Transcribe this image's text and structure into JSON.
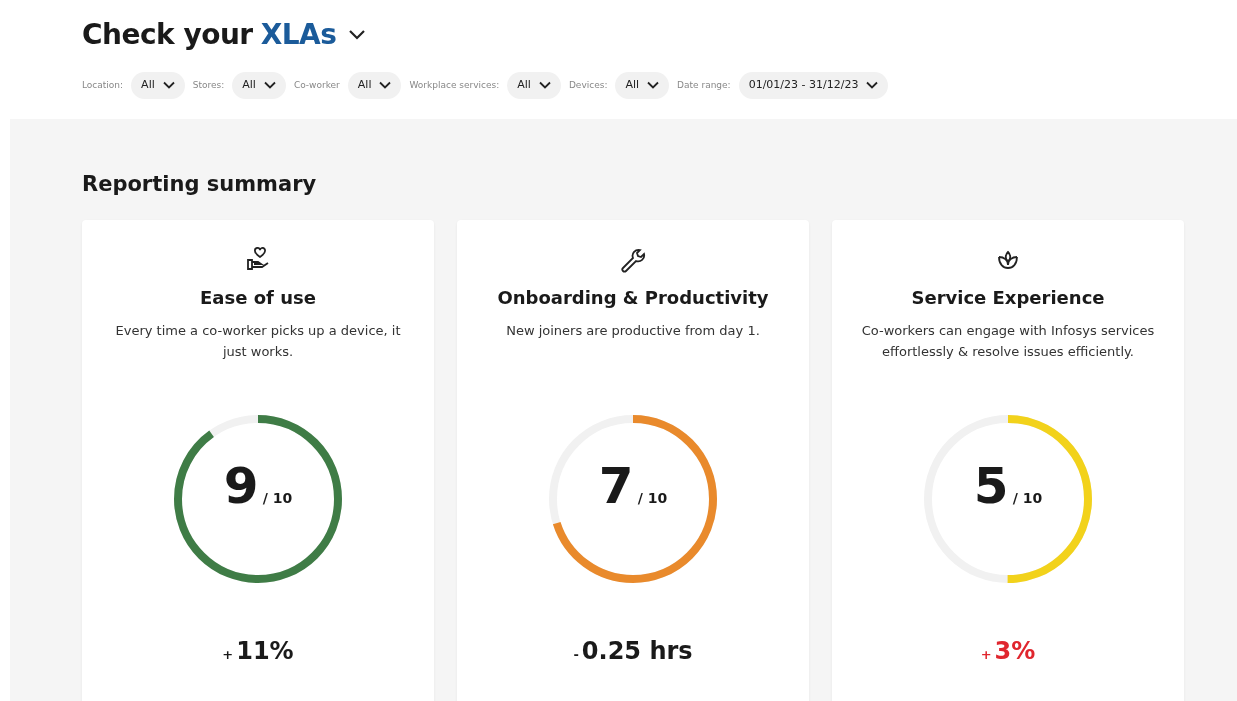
{
  "header": {
    "title_prefix": "Check your",
    "title_highlight": "XLAs"
  },
  "filters": [
    {
      "label": "Location:",
      "value": "All"
    },
    {
      "label": "Stores:",
      "value": "All"
    },
    {
      "label": "Co-worker",
      "value": "All"
    },
    {
      "label": "Workplace services:",
      "value": "All"
    },
    {
      "label": "Devices:",
      "value": "All"
    },
    {
      "label": "Date range:",
      "value": "01/01/23 - 31/12/23"
    }
  ],
  "summary": {
    "title": "Reporting summary",
    "cards": [
      {
        "title": "Ease of use",
        "description": "Every time a co-worker picks up a device, it just works.",
        "score": "9",
        "max": "/ 10",
        "level": 0.9,
        "color": "#3f7c46",
        "delta": {
          "sign": "+",
          "value": "11%",
          "color": "#1a1a1a"
        }
      },
      {
        "title": "Onboarding & Productivity",
        "description": "New joiners are productive from day 1.",
        "score": "7",
        "max": "/ 10",
        "level": 0.7,
        "color": "#e98a2c",
        "delta": {
          "sign": "-",
          "value": "0.25 hrs",
          "color": "#1a1a1a"
        }
      },
      {
        "title": "Service Experience",
        "description": "Co-workers can engage with Infosys services effortlessly & resolve issues efficiently.",
        "score": "5",
        "max": "/ 10",
        "level": 0.5,
        "color": "#f2d21b",
        "delta": {
          "sign": "+",
          "value": "3%",
          "color": "#e0262e"
        }
      }
    ]
  }
}
